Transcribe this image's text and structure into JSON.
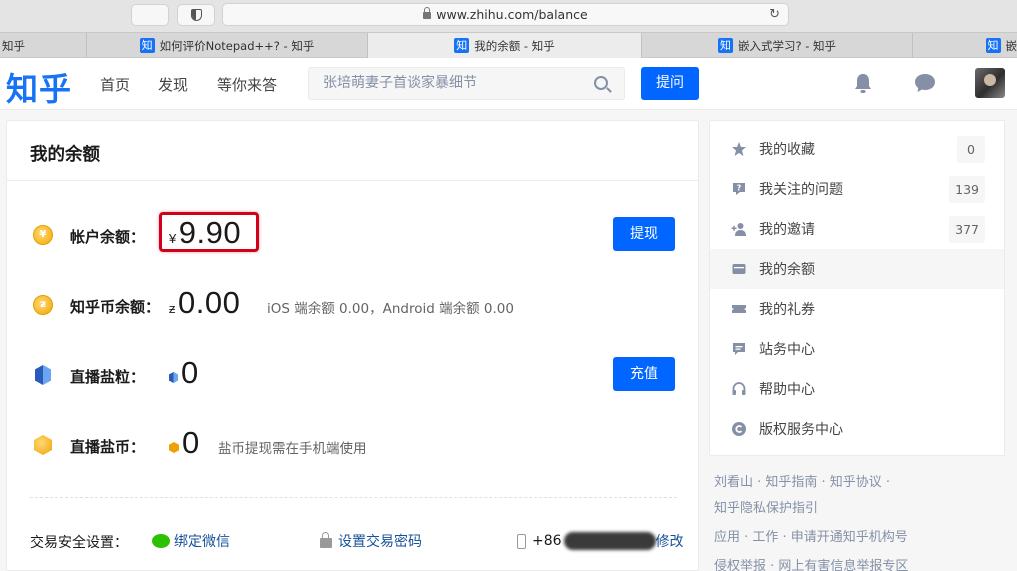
{
  "browser": {
    "url": "www.zhihu.com/balance",
    "tabs": [
      "知乎",
      "如何评价Notepad++? - 知乎",
      "我的余额 - 知乎",
      "嵌入式学习? - 知乎",
      "嵌"
    ],
    "favicon_char": "知"
  },
  "header": {
    "logo": "知乎",
    "nav": [
      "首页",
      "发现",
      "等你来答"
    ],
    "search_placeholder": "张培萌妻子首谈家暴细节",
    "ask_label": "提问"
  },
  "balance": {
    "title": "我的余额",
    "account": {
      "label": "帐户余额：",
      "currency": "¥",
      "amount": "9.90",
      "action": "提现"
    },
    "coins": {
      "label": "知乎币余额：",
      "currency": "ƶ",
      "amount": "0.00",
      "note": "iOS 端余额 0.00，Android 端余额 0.00"
    },
    "salt_grain": {
      "label": "直播盐粒：",
      "amount": "0",
      "action": "充值"
    },
    "salt_coin": {
      "label": "直播盐币：",
      "amount": "0",
      "note": "盐币提现需在手机端使用"
    },
    "security": {
      "label": "交易安全设置：",
      "wechat": "绑定微信",
      "password": "设置交易密码",
      "phone_prefix": "+86",
      "phone_action": "修改"
    }
  },
  "sidebar": {
    "items": [
      {
        "label": "我的收藏",
        "count": "0",
        "icon": "star-icon"
      },
      {
        "label": "我关注的问题",
        "count": "139",
        "icon": "question-icon"
      },
      {
        "label": "我的邀请",
        "count": "377",
        "icon": "invite-icon"
      },
      {
        "label": "我的余额",
        "count": "",
        "icon": "wallet-icon"
      },
      {
        "label": "我的礼券",
        "count": "",
        "icon": "coupon-icon"
      },
      {
        "label": "站务中心",
        "count": "",
        "icon": "message-icon"
      },
      {
        "label": "帮助中心",
        "count": "",
        "icon": "headset-icon"
      },
      {
        "label": "版权服务中心",
        "count": "",
        "icon": "copyright-icon"
      }
    ]
  },
  "footer": {
    "line1": "刘看山 · 知乎指南 · 知乎协议 ·",
    "line2": "知乎隐私保护指引",
    "line3": "应用 · 工作 · 申请开通知乎机构号",
    "line4": "侵权举报 · 网上有害信息举报专区"
  },
  "colors": {
    "brand": "#0066ff",
    "highlight": "#d0021b"
  }
}
